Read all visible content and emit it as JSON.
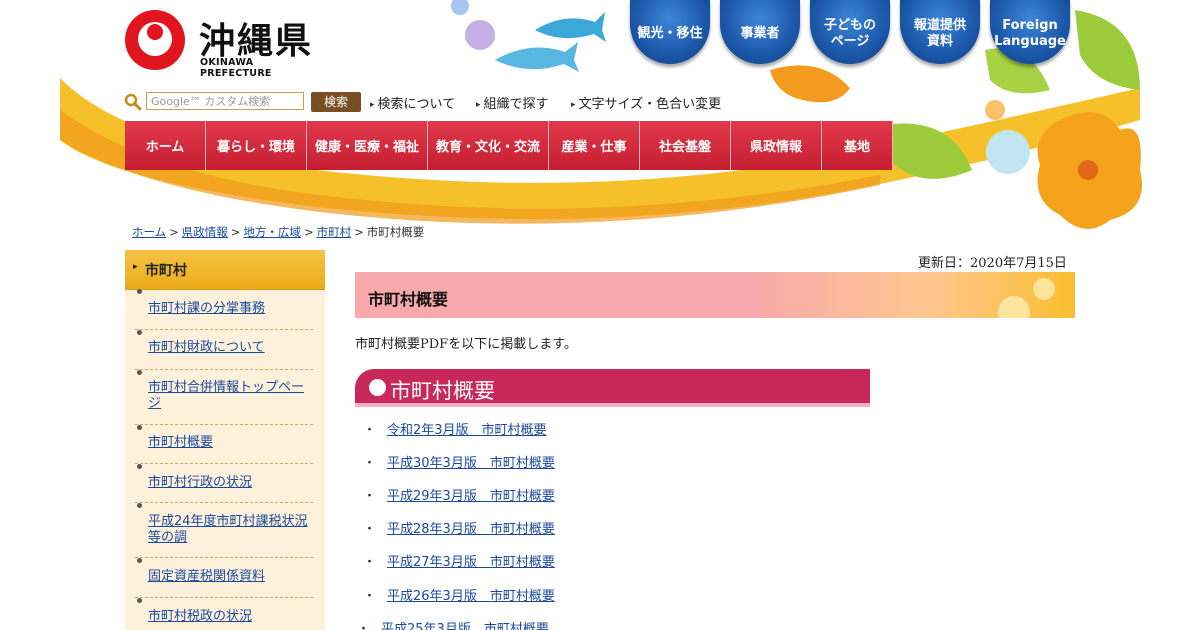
{
  "logo": {
    "kanji": "沖縄県",
    "english": "OKINAWA PREFECTURE"
  },
  "round_nav": [
    {
      "label": "観光・移住"
    },
    {
      "label": "事業者"
    },
    {
      "label": "子どもの\nページ"
    },
    {
      "label": "報道提供\n資料"
    },
    {
      "label": "Foreign\nLanguage"
    }
  ],
  "search": {
    "placeholder": "Google™ カスタム検索",
    "button": "検索",
    "links": [
      "検索について",
      "組織で探す",
      "文字サイズ・色合い変更"
    ]
  },
  "nav": [
    "ホーム",
    "暮らし・環境",
    "健康・医療・福祉",
    "教育・文化・交流",
    "産業・仕事",
    "社会基盤",
    "県政情報",
    "基地"
  ],
  "breadcrumb": {
    "links": [
      "ホーム",
      "県政情報",
      "地方・広域",
      "市町村"
    ],
    "separator": ">",
    "current": "市町村概要"
  },
  "sidebar": {
    "title": "市町村",
    "items": [
      "市町村課の分掌事務",
      "市町村財政について",
      "市町村合併情報トップページ",
      "市町村概要",
      "市町村行政の状況",
      "平成24年度市町村課税状況等の調",
      "固定資産税関係資料",
      "市町村税政の状況"
    ]
  },
  "main": {
    "updated": "更新日：2020年7月15日",
    "title": "市町村概要",
    "intro": "市町村概要PDFを以下に掲載します。",
    "section_title": "市町村概要",
    "bullet": "・",
    "documents": [
      "令和2年3月版　市町村概要",
      "平成30年3月版　市町村概要",
      "平成29年3月版　市町村概要",
      "平成28年3月版　市町村概要",
      "平成27年3月版　市町村概要",
      "平成26年3月版　市町村概要",
      "平成25年3月版　市町村概要"
    ]
  },
  "colors": {
    "nav_red": "#c51e31",
    "sidebar_yellow": "#ebac18",
    "section_magenta": "#c8295a",
    "link_blue": "#1a4a9c",
    "round_button_blue": "#1b56a8"
  }
}
